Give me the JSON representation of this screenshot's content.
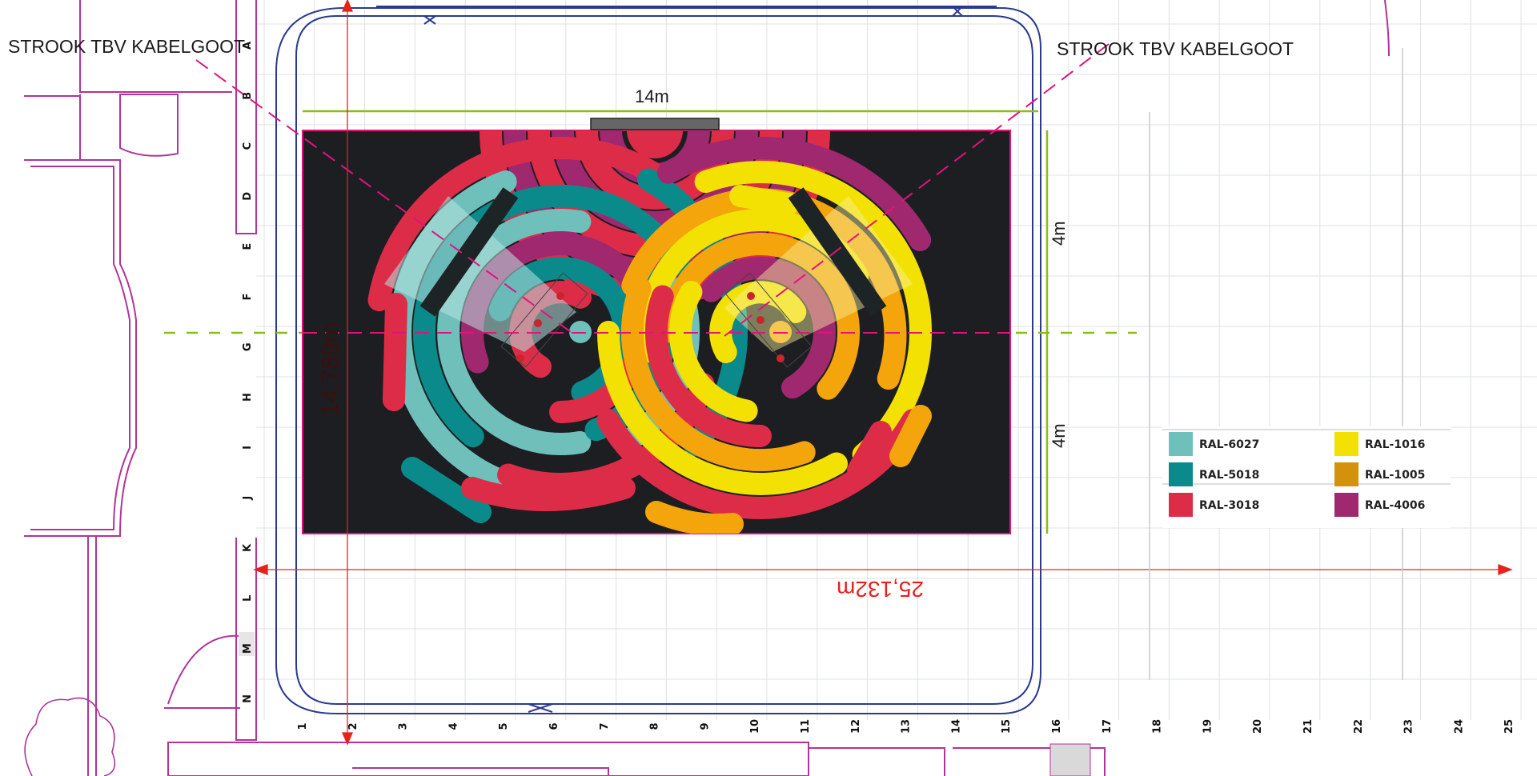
{
  "labels": {
    "left_strip": "STROOK TBV KABELGOOT",
    "right_strip": "STROOK TBV KABELGOOT",
    "top_dim": "14m",
    "side_dim_top": "4m",
    "side_dim_bottom": "4m",
    "height_dim": "14,789m",
    "width_dim": "25,132m"
  },
  "row_labels": [
    "A",
    "B",
    "C",
    "D",
    "E",
    "F",
    "G",
    "H",
    "I",
    "J",
    "K",
    "L",
    "M",
    "N"
  ],
  "column_labels": [
    "1",
    "2",
    "3",
    "4",
    "5",
    "6",
    "7",
    "8",
    "9",
    "10",
    "11",
    "12",
    "13",
    "14",
    "15",
    "16",
    "17",
    "18",
    "19",
    "20",
    "21",
    "22",
    "23",
    "24",
    "25"
  ],
  "legend": [
    {
      "code": "RAL-6027",
      "color": "#6fc0bb"
    },
    {
      "code": "RAL-1016",
      "color": "#f4e104"
    },
    {
      "code": "RAL-5018",
      "color": "#0a8a8a"
    },
    {
      "code": "RAL-1005",
      "color": "#d4910c"
    },
    {
      "code": "RAL-3018",
      "color": "#dd2c48"
    },
    {
      "code": "RAL-4006",
      "color": "#a0286e"
    }
  ],
  "colors": {
    "floor": "#1d1e22",
    "floor_border": "#e0147c",
    "track": "#2b3a8f",
    "wall": "#b0359a",
    "grid": "#d9dde3",
    "green_dim": "#8dbb1e",
    "red_dim": "#e8211c",
    "pink_dash": "#e0147c"
  }
}
